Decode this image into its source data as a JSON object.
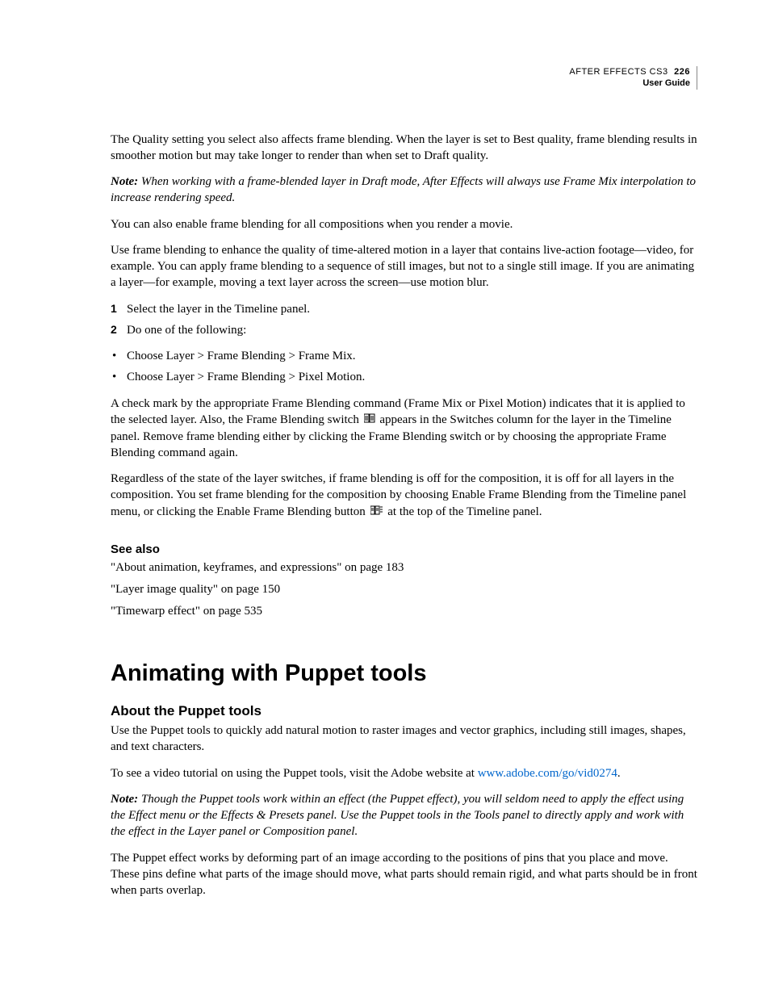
{
  "header": {
    "product": "AFTER EFFECTS CS3",
    "page_number": "226",
    "subtitle": "User Guide"
  },
  "paragraphs": {
    "p1": "The Quality setting you select also affects frame blending. When the layer is set to Best quality, frame blending results in smoother motion but may take longer to render than when set to Draft quality.",
    "note1_label": "Note:",
    "note1_body": " When working with a frame-blended layer in Draft mode, After Effects will always use Frame Mix interpolation to increase rendering speed.",
    "p2": "You can also enable frame blending for all compositions when you render a movie.",
    "p3": "Use frame blending to enhance the quality of time-altered motion in a layer that contains live-action footage—video, for example. You can apply frame blending to a sequence of still images, but not to a single still image. If you are animating a layer—for example, moving a text layer across the screen—use motion blur.",
    "step1": "Select the layer in the Timeline panel.",
    "step2": "Do one of the following:",
    "bullet1": "Choose Layer > Frame Blending > Frame Mix.",
    "bullet2": "Choose Layer > Frame Blending > Pixel Motion.",
    "p4a": "A check mark by the appropriate Frame Blending command (Frame Mix or Pixel Motion) indicates that it is applied to the selected layer. Also, the Frame Blending switch ",
    "p4b": " appears in the Switches column for the layer in the Timeline panel. Remove frame blending either by clicking the Frame Blending switch or by choosing the appropriate Frame Blending command again.",
    "p5a": "Regardless of the state of the layer switches, if frame blending is off for the composition, it is off for all layers in the composition. You set frame blending for the composition by choosing Enable Frame Blending from the Timeline panel menu, or clicking the Enable Frame Blending button ",
    "p5b": " at the top of the Timeline panel."
  },
  "see_also": {
    "heading": "See also",
    "links": [
      "\"About animation, keyframes, and expressions\" on page 183",
      "\"Layer image quality\" on page 150",
      "\"Timewarp effect\" on page 535"
    ]
  },
  "section": {
    "title": "Animating with Puppet tools",
    "sub_title": "About the Puppet tools",
    "p1": "Use the Puppet tools to quickly add natural motion to raster images and vector graphics, including still images, shapes, and text characters.",
    "p2a": "To see a video tutorial on using the Puppet tools, visit the Adobe website at ",
    "p2_link": "www.adobe.com/go/vid0274",
    "p2b": ".",
    "note_label": "Note:",
    "note_body": " Though the Puppet tools work within an effect (the Puppet effect), you will seldom need to apply the effect using the Effect menu or the Effects & Presets panel. Use the Puppet tools in the Tools panel to directly apply and work with the effect in the Layer panel or Composition panel.",
    "p3": "The Puppet effect works by deforming part of an image according to the positions of pins that you place and move. These pins define what parts of the image should move, what parts should remain rigid, and what parts should be in front when parts overlap."
  }
}
